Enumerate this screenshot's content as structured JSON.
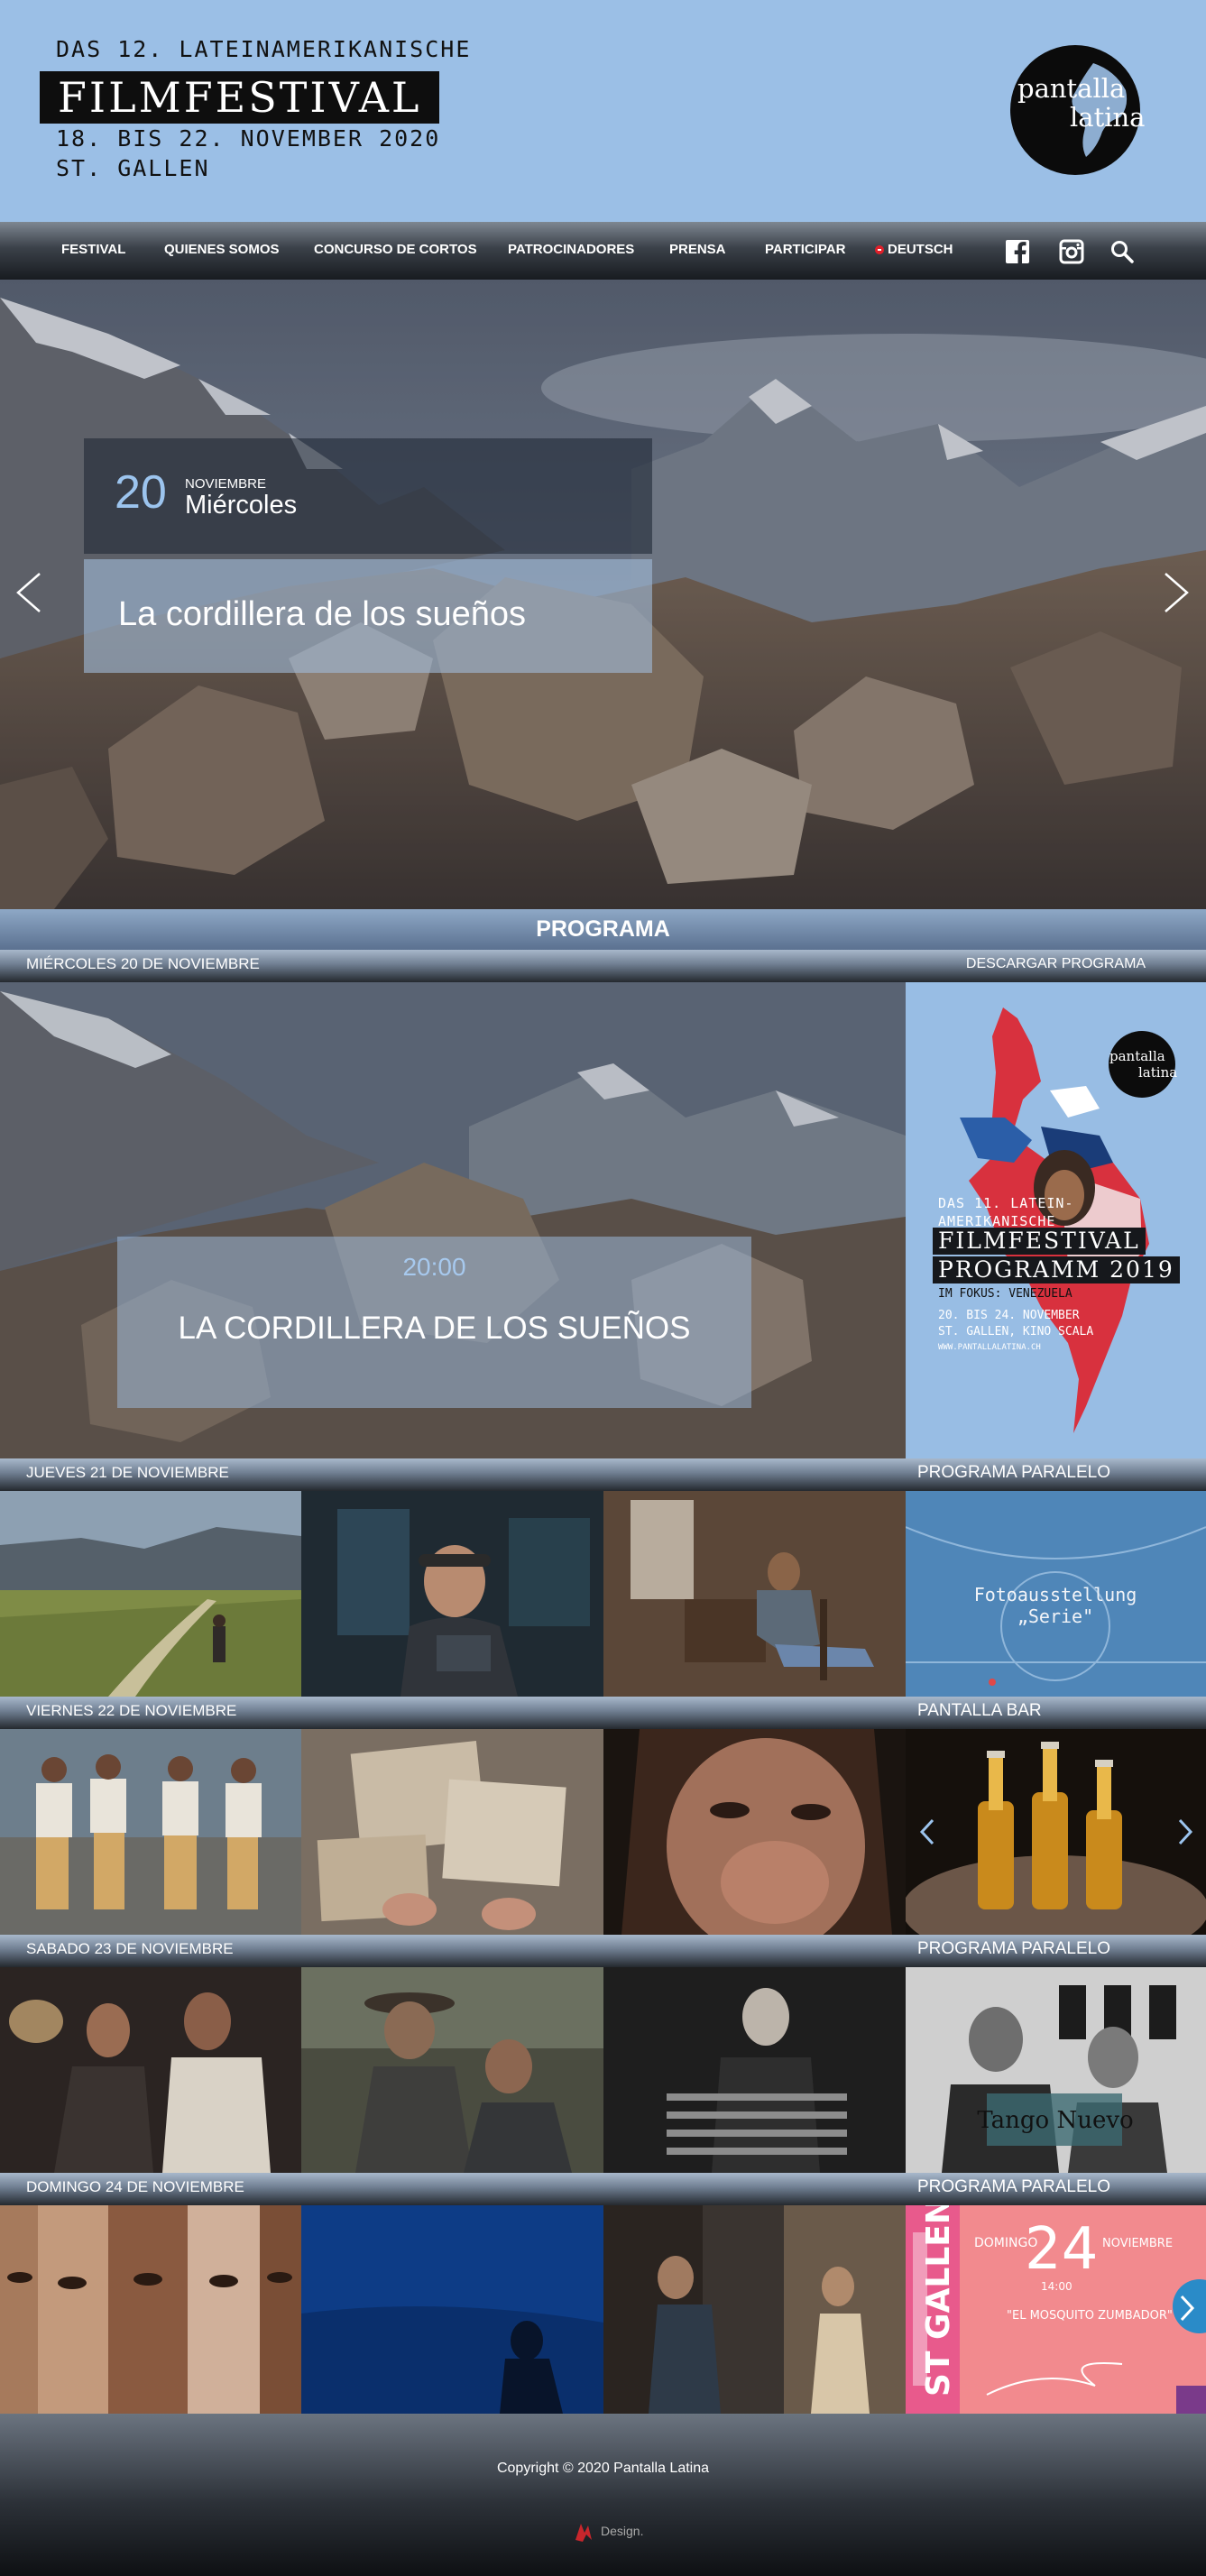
{
  "header": {
    "festival_line1": "DAS 12. LATEINAMERIKANISCHE",
    "festival_title": "FILMFESTIVAL",
    "dates": "18. BIS 22. NOVEMBER 2020",
    "city": "ST. GALLEN",
    "logo_line1": "pantalla",
    "logo_line2": "latina"
  },
  "nav": {
    "items": [
      "FESTIVAL",
      "QUIENES SOMOS",
      "CONCURSO DE CORTOS",
      "PATROCINADORES",
      "PRENSA",
      "PARTICIPAR"
    ],
    "language": "DEUTSCH",
    "icons": [
      "facebook-icon",
      "instagram-icon",
      "search-icon"
    ]
  },
  "hero": {
    "day_number": "20",
    "month": "NOVIEMBRE",
    "weekday": "Miércoles",
    "title": "La cordillera de los sueños"
  },
  "program": {
    "heading": "PROGRAMA",
    "download_label": "DESCARGAR PROGRAMA",
    "featured_day": "MIÉRCOLES 20 DE NOVIEMBRE",
    "featured_time": "20:00",
    "featured_title": "LA CORDILLERA DE LOS SUEÑOS",
    "poster": {
      "line1": "DAS 11. LATEIN-",
      "line2": "AMERIKANISCHE",
      "box1": "FILMFESTIVAL",
      "box2": "PROGRAMM 2019",
      "focus": "IM FOKUS: VENEZUELA",
      "dates": "20. BIS 24. NOVEMBER",
      "place": "ST. GALLEN, KINO SCALA",
      "url": "WWW.PANTALLALATINA.CH"
    },
    "days": [
      {
        "label": "JUEVES 21 DE NOVIEMBRE",
        "side_label": "PROGRAMA PARALELO",
        "side_caption_1": "Fotoausstellung",
        "side_caption_2": "„Serie\""
      },
      {
        "label": "VIERNES 22 DE NOVIEMBRE",
        "side_label": "PANTALLA BAR"
      },
      {
        "label": "SABADO 23 DE NOVIEMBRE",
        "side_label": "PROGRAMA PARALELO",
        "side_caption_1": "Tango Nuevo"
      },
      {
        "label": "DOMINGO 24 DE NOVIEMBRE",
        "side_label": "PROGRAMA PARALELO",
        "side_caption_1": "ST GALLEN",
        "side_caption_2": "DOMINGO",
        "side_caption_3": "24",
        "side_caption_4": "NOVIEMBRE",
        "side_caption_5": "14:00",
        "side_caption_6": "\"EL MOSQUITO ZUMBADOR\""
      }
    ]
  },
  "footer": {
    "copyright": "Copyright © 2020 Pantalla Latina",
    "design_credit": "Design."
  },
  "colors": {
    "header_bg": "#9bbfe6",
    "accent_blue": "#9cc4ee",
    "nav_dark": "#1c1f24"
  }
}
